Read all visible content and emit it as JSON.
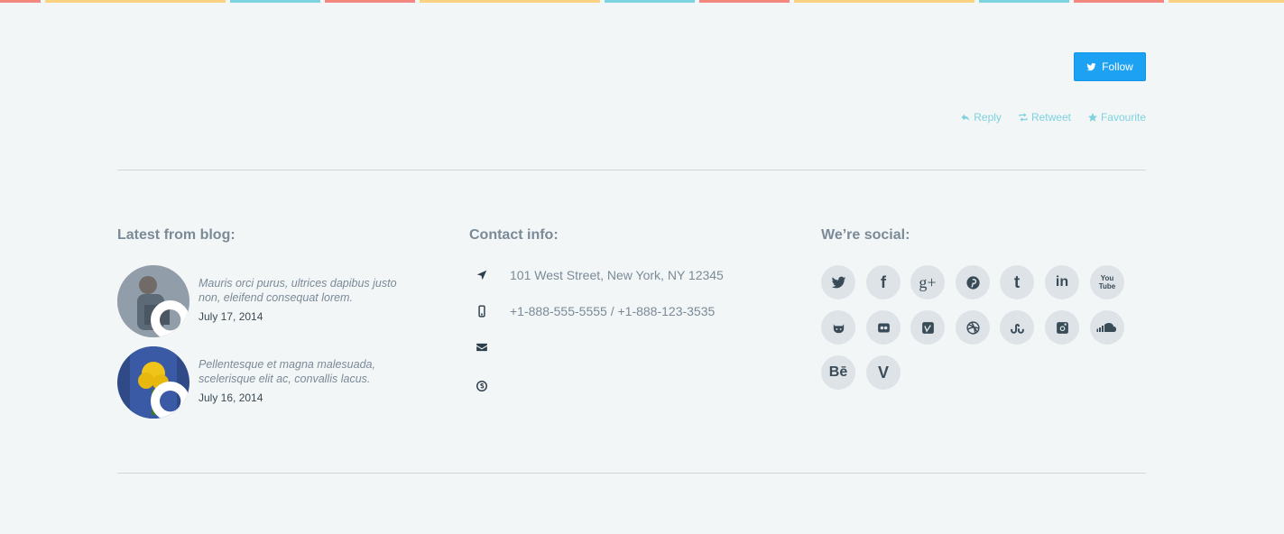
{
  "colors": {
    "accent_cyan": "#7dd3df",
    "twitter_blue": "#1da1f2",
    "stripe_red": "#f4877f",
    "stripe_yellow": "#fbd27f",
    "stripe_cyan": "#7dd3df"
  },
  "twitter": {
    "follow_label": "Follow",
    "actions": [
      {
        "label": "Reply",
        "icon": "reply-icon"
      },
      {
        "label": "Retweet",
        "icon": "retweet-icon"
      },
      {
        "label": "Favourite",
        "icon": "star-icon"
      }
    ]
  },
  "blog": {
    "title": "Latest from blog:",
    "posts": [
      {
        "excerpt": "Mauris orci purus, ultrices dapibus justo non, eleifend consequat lorem.",
        "date": "July 17, 2014"
      },
      {
        "excerpt": "Pellentesque et magna malesuada, scelerisque elit ac, convallis lacus.",
        "date": "July 16, 2014"
      }
    ]
  },
  "contact": {
    "title": "Contact info:",
    "items": [
      {
        "icon": "location-arrow-icon",
        "text": "101 West Street, New York, NY 12345"
      },
      {
        "icon": "mobile-phone-icon",
        "text": "+1-888-555-5555 / +1-888-123-3535"
      },
      {
        "icon": "envelope-icon",
        "text": ""
      },
      {
        "icon": "skype-icon",
        "text": ""
      }
    ]
  },
  "social": {
    "title": "We’re social:",
    "networks": [
      "twitter",
      "facebook",
      "google-plus",
      "pinterest",
      "tumblr",
      "linkedin",
      "youtube",
      "github",
      "flickr",
      "vimeo",
      "dribbble",
      "stumbleupon",
      "instagram",
      "soundcloud",
      "behance",
      "vine"
    ],
    "glyphs": {
      "twitter": "",
      "facebook": "f",
      "google-plus": "g+",
      "pinterest": "",
      "tumblr": "t",
      "linkedin": "in",
      "youtube": "You Tube",
      "github": "",
      "flickr": "",
      "vimeo": "v",
      "dribbble": "",
      "stumbleupon": "su",
      "instagram": "",
      "soundcloud": "",
      "behance": "Bē",
      "vine": "V"
    }
  }
}
